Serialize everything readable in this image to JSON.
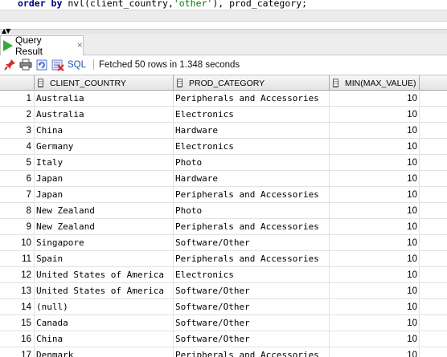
{
  "editor": {
    "kw": "order by",
    "mid": " nvl(client_country,",
    "str": "'other'",
    "tail": "), prod_category;"
  },
  "tab": {
    "label": "Query Result",
    "close": "×"
  },
  "toolbar": {
    "sql_label": "SQL",
    "status": "Fetched 50 rows in 1.348 seconds"
  },
  "grid": {
    "columns": [
      "CLIENT_COUNTRY",
      "PROD_CATEGORY",
      "MIN(MAX_VALUE)"
    ],
    "rows": [
      {
        "n": "1",
        "country": "Australia",
        "category": "Peripherals and Accessories",
        "min": "10"
      },
      {
        "n": "2",
        "country": "Australia",
        "category": "Electronics",
        "min": "10"
      },
      {
        "n": "3",
        "country": "China",
        "category": "Hardware",
        "min": "10"
      },
      {
        "n": "4",
        "country": "Germany",
        "category": "Electronics",
        "min": "10"
      },
      {
        "n": "5",
        "country": "Italy",
        "category": "Photo",
        "min": "10"
      },
      {
        "n": "6",
        "country": "Japan",
        "category": "Hardware",
        "min": "10"
      },
      {
        "n": "7",
        "country": "Japan",
        "category": "Peripherals and Accessories",
        "min": "10"
      },
      {
        "n": "8",
        "country": "New Zealand",
        "category": "Photo",
        "min": "10"
      },
      {
        "n": "9",
        "country": "New Zealand",
        "category": "Peripherals and Accessories",
        "min": "10"
      },
      {
        "n": "10",
        "country": "Singapore",
        "category": "Software/Other",
        "min": "10"
      },
      {
        "n": "11",
        "country": "Spain",
        "category": "Peripherals and Accessories",
        "min": "10"
      },
      {
        "n": "12",
        "country": "United States of America",
        "category": "Electronics",
        "min": "10"
      },
      {
        "n": "13",
        "country": "United States of America",
        "category": "Software/Other",
        "min": "10"
      },
      {
        "n": "14",
        "country": "(null)",
        "category": "Software/Other",
        "min": "10"
      },
      {
        "n": "15",
        "country": "Canada",
        "category": "Software/Other",
        "min": "10"
      },
      {
        "n": "16",
        "country": "China",
        "category": "Software/Other",
        "min": "10"
      },
      {
        "n": "17",
        "country": "Denmark",
        "category": "Peripherals and Accessories",
        "min": "10"
      }
    ]
  }
}
